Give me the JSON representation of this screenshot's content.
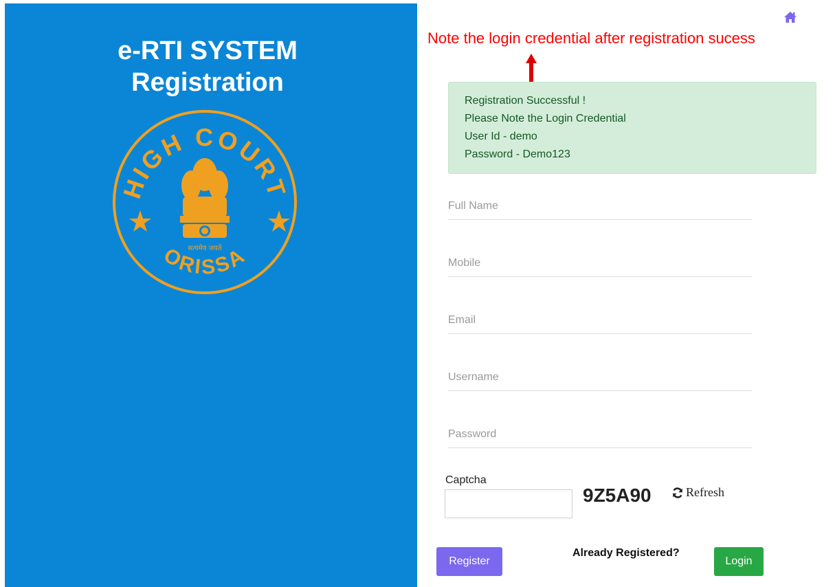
{
  "left_panel": {
    "title_line1": "e-RTI SYSTEM",
    "title_line2": "Registration",
    "background_color": "#0b86d6",
    "seal": {
      "top_text": "HIGH COURT",
      "bottom_text": "ORISSA",
      "motto": "सत्यमेव जयते",
      "color": "#f0a020"
    }
  },
  "header": {
    "home_icon": "home-icon",
    "note": "Note the login credential after registration sucess"
  },
  "alert": {
    "line1": "Registration Successful !",
    "line2": "Please Note the Login Credential",
    "line3": "User Id - demo",
    "line4": "Password - Demo123"
  },
  "form": {
    "full_name_placeholder": "Full Name",
    "mobile_placeholder": "Mobile",
    "email_placeholder": "Email",
    "username_placeholder": "Username",
    "password_placeholder": "Password",
    "captcha_label": "Captcha",
    "captcha_code": "9Z5A90",
    "refresh_label": "Refresh",
    "register_label": "Register",
    "already_registered": "Already Registered?",
    "login_label": "Login"
  },
  "colors": {
    "accent_purple": "#7b68ee",
    "login_green": "#28a745",
    "alert_bg": "#d4edda",
    "note_red": "#ff0000"
  }
}
